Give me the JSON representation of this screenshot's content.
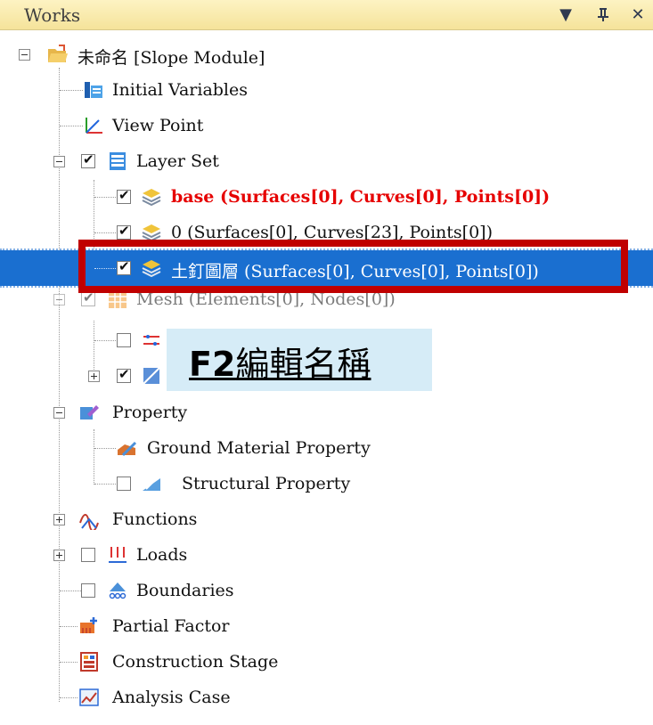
{
  "titlebar": {
    "title": "Works",
    "dropdown_glyph": "▼",
    "pin_glyph": "ꟾ",
    "close_glyph": "✕"
  },
  "tree": {
    "root": "未命名 [Slope Module]",
    "initial_variables": "Initial Variables",
    "view_point": "View Point",
    "layer_set": "Layer Set",
    "layers": [
      {
        "label": "base (Surfaces[0], Curves[0], Points[0])",
        "checked": true
      },
      {
        "label": "0 (Surfaces[0], Curves[23], Points[0])",
        "checked": true
      },
      {
        "label": "土釘圖層 (Surfaces[0], Curves[0], Points[0])",
        "checked": true
      }
    ],
    "mesh": "Mesh (Elements[0], Nodes[0])",
    "property": "Property",
    "ground_material_property": "Ground Material Property",
    "structural_property": "Structural Property",
    "functions": "Functions",
    "loads": "Loads",
    "boundaries": "Boundaries",
    "partial_factor": "Partial Factor",
    "construction_stage": "Construction Stage",
    "analysis_case": "Analysis Case"
  },
  "callout": {
    "key": "F2",
    "text": "編輯名稱"
  },
  "colors": {
    "selection": "#1a6fd0",
    "highlight_box": "#c00000",
    "callout_bg": "#d6ecf7",
    "base_text": "#e60000"
  }
}
